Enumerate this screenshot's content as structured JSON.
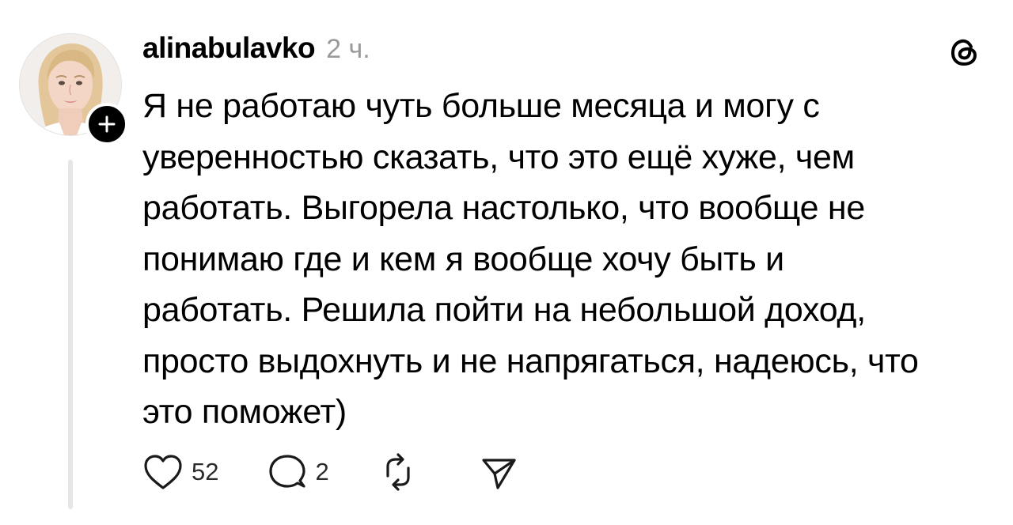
{
  "post": {
    "username": "alinabulavko",
    "timestamp": "2 ч.",
    "text": "Я не работаю чуть больше месяца и могу с\nуверенностью сказать, что это ещё хуже, чем\nработать. Выгорела настолько, что вообще не\nпонимаю где и кем я вообще хочу быть и\nработать. Решила пойти на небольшой доход,\nпросто выдохнуть и не напрягаться, надеюсь, что\nэто поможет)"
  },
  "actions": {
    "likes": "52",
    "replies": "2"
  },
  "icons": {
    "avatar": "avatar-photo",
    "follow": "plus-icon",
    "logo": "threads-logo-icon",
    "like": "heart-icon",
    "reply": "comment-icon",
    "repost": "repost-icon",
    "share": "send-icon"
  },
  "colors": {
    "text": "#000000",
    "muted": "#9a9a9a",
    "thread_line": "#e6e6e6"
  }
}
